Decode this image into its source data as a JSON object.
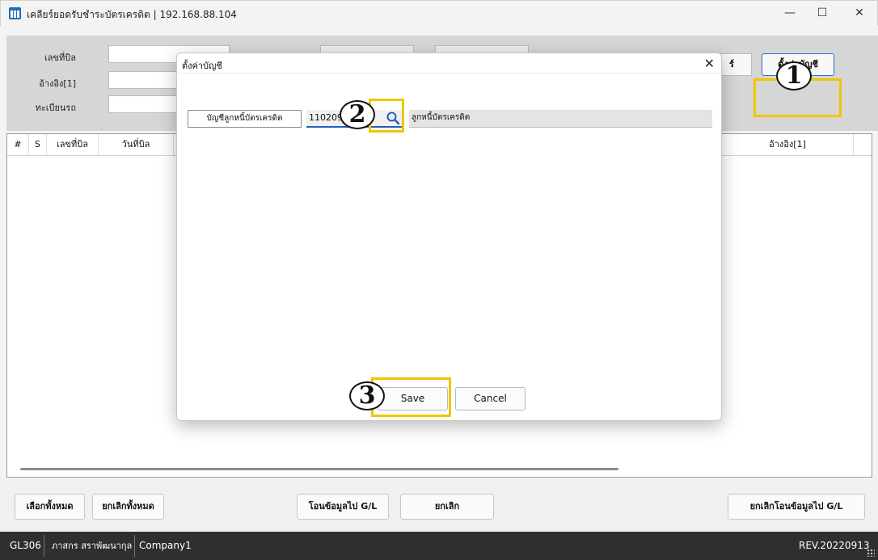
{
  "window": {
    "title": "เคลียร์ยอดรับชำระบัตรเครดิต | 192.168.88.104",
    "minimize": "—",
    "maximize": "☐",
    "close": "✕"
  },
  "filters": {
    "bill_no_label": "เลขที่บิล",
    "ref1_label": "อ้างอิง[1]",
    "plate_label": "ทะเบียนรถ",
    "partial_button": "ร์",
    "setup_button": "ตั้งค่าบัญชี"
  },
  "grid": {
    "columns": [
      "#",
      "S",
      "เลขที่บิล",
      "วันที่บิล",
      "อ้างอิง[1]"
    ]
  },
  "dialog": {
    "title": "ตั้งค่าบัญชี",
    "close": "✕",
    "account_label": "บัญชีลูกหนี้บัตรเครดิต",
    "account_code": "110209",
    "account_name": "ลูกหนี้บัตรเครดิต",
    "save": "Save",
    "cancel": "Cancel"
  },
  "bottom_buttons": {
    "select_all": "เลือกทั้งหมด",
    "unselect_all": "ยกเลิกทั้งหมด",
    "transfer_gl": "โอนข้อมูลไป G/L",
    "cancel": "ยกเลิก",
    "cancel_transfer_gl": "ยกเลิกโอนข้อมูลไป G/L"
  },
  "status": {
    "code": "GL306",
    "user": "ภาสกร สราพัฒนากุล",
    "company": "Company1",
    "revision": "REV.20220913"
  },
  "callouts": {
    "step1": "1",
    "step2": "2",
    "step3": "3",
    "color": "#f2c500"
  }
}
